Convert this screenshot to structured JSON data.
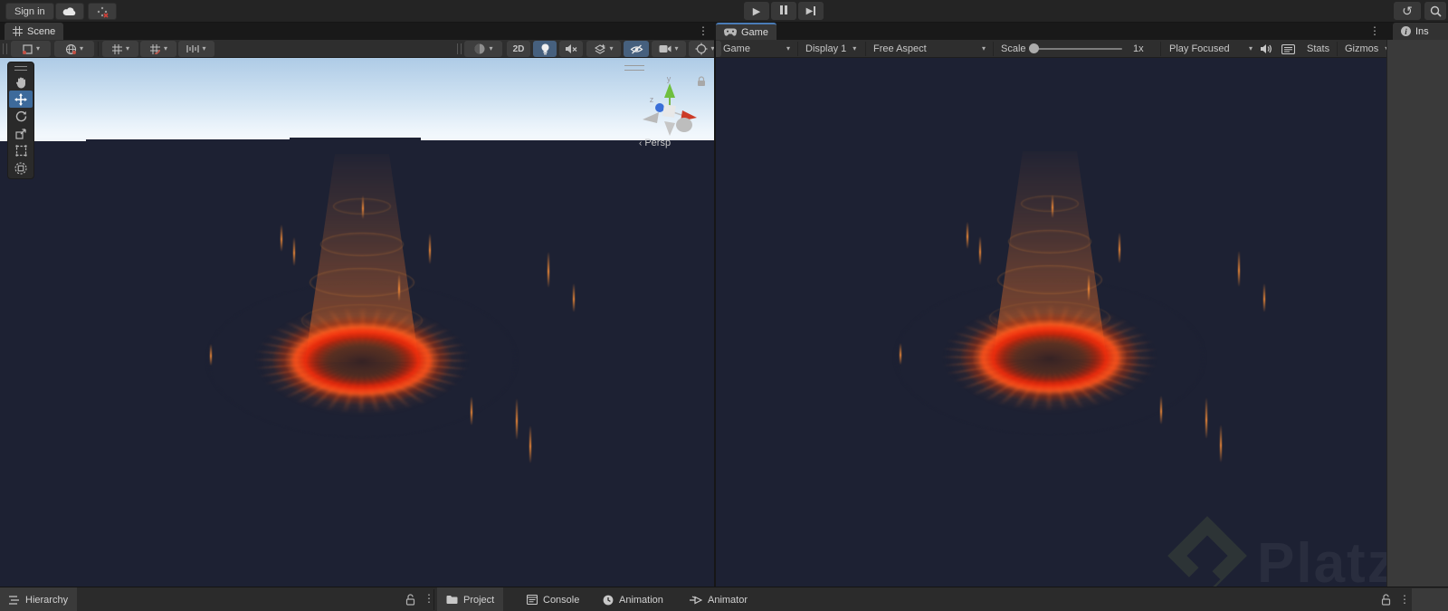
{
  "topbar": {
    "sign_in": "Sign in",
    "play_tooltip": "Play",
    "pause_tooltip": "Pause",
    "step_tooltip": "Step"
  },
  "tabs": {
    "scene": "Scene",
    "game": "Game",
    "inspector": "Ins"
  },
  "scene_toolbar": {
    "label_2d": "2D"
  },
  "game_toolbar": {
    "game_dropdown": "Game",
    "display_dropdown": "Display 1",
    "aspect_dropdown": "Free Aspect",
    "scale_label": "Scale",
    "scale_value": "1x",
    "play_focused_dropdown": "Play Focused",
    "stats_label": "Stats",
    "gizmos_dropdown": "Gizmos"
  },
  "scene_view": {
    "persp_label": "Persp",
    "gizmo_axis_y": "y",
    "gizmo_axis_z": "z"
  },
  "bottom_tabs": {
    "hierarchy": "Hierarchy",
    "project": "Project",
    "console": "Console",
    "animation": "Animation",
    "animator": "Animator"
  },
  "watermark": {
    "brand": "Platzi"
  },
  "colors": {
    "accent_blue": "#4a7cb8",
    "selected_tool_blue": "#3d6a9b",
    "active_toggle_blue": "#46607e",
    "viewport_navy": "#1d2133",
    "fire_red": "#ee2c0c",
    "fire_orange": "#ff7a2e",
    "sky_top": "#aecbe6",
    "sky_horizon": "#f3f8fc",
    "axis_x_red": "#c0392b",
    "axis_y_green": "#6fbf3f",
    "axis_z_blue": "#3a6fd8"
  }
}
